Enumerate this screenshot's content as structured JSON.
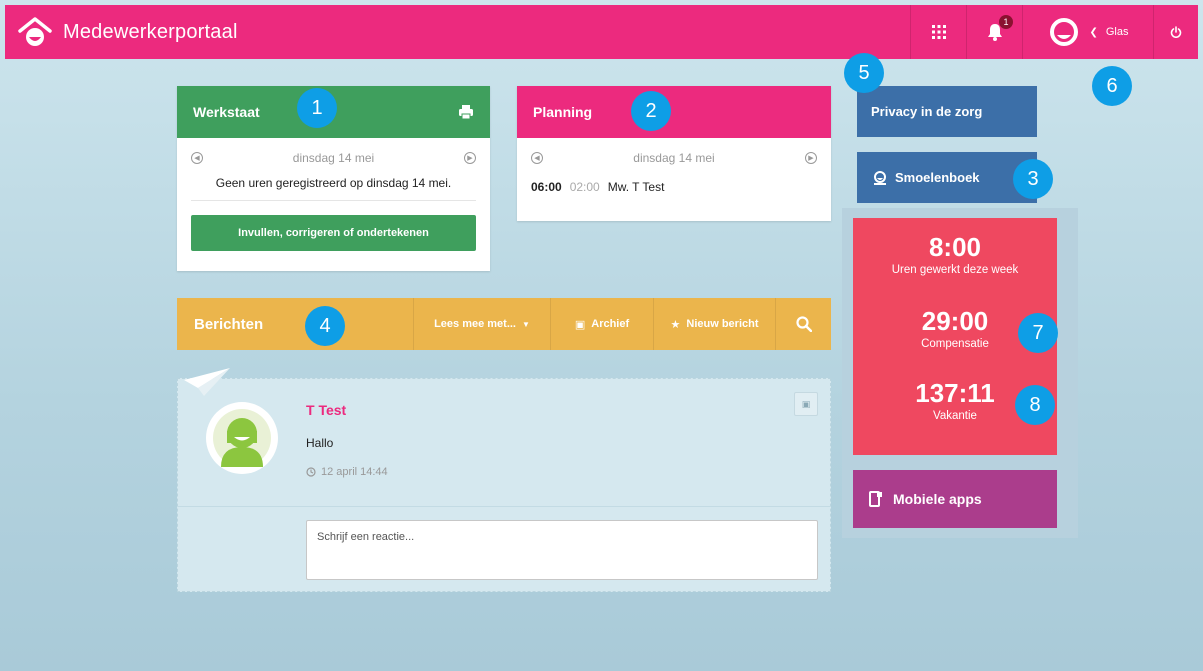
{
  "header": {
    "title": "Medewerkerportaal",
    "notification_count": "1",
    "user_name": "Glas"
  },
  "werkstaat": {
    "title": "Werkstaat",
    "date": "dinsdag 14 mei",
    "empty_text": "Geen uren geregistreerd op dinsdag 14 mei.",
    "action_label": "Invullen, corrigeren of ondertekenen"
  },
  "planning": {
    "title": "Planning",
    "date": "dinsdag 14 mei",
    "entry": {
      "start": "06:00",
      "end": "02:00",
      "name": "Mw. T Test"
    }
  },
  "sidebar": {
    "privacy_label": "Privacy in de zorg",
    "smoelenboek_label": "Smoelenboek",
    "stats": [
      {
        "value": "8:00",
        "label": "Uren gewerkt deze week"
      },
      {
        "value": "29:00",
        "label": "Compensatie"
      },
      {
        "value": "137:11",
        "label": "Vakantie"
      }
    ],
    "mobile_label": "Mobiele apps"
  },
  "berichten": {
    "title": "Berichten",
    "lees_label": "Lees mee met...",
    "archief_label": "Archief",
    "nieuw_label": "Nieuw bericht"
  },
  "message": {
    "author": "T Test",
    "text": "Hallo",
    "time": "12 april 14:44",
    "reply_placeholder": "Schrijf een reactie..."
  },
  "callouts": [
    "1",
    "2",
    "3",
    "4",
    "5",
    "6",
    "7",
    "8"
  ],
  "colors": {
    "brand": "#ec2a7e",
    "werkstaat": "#3f9f5d",
    "berichten": "#ebb54c",
    "side_blue": "#3c6fa8",
    "stats": "#ef4860",
    "mobile": "#ab3d8c",
    "callout": "#0e9ee6"
  }
}
